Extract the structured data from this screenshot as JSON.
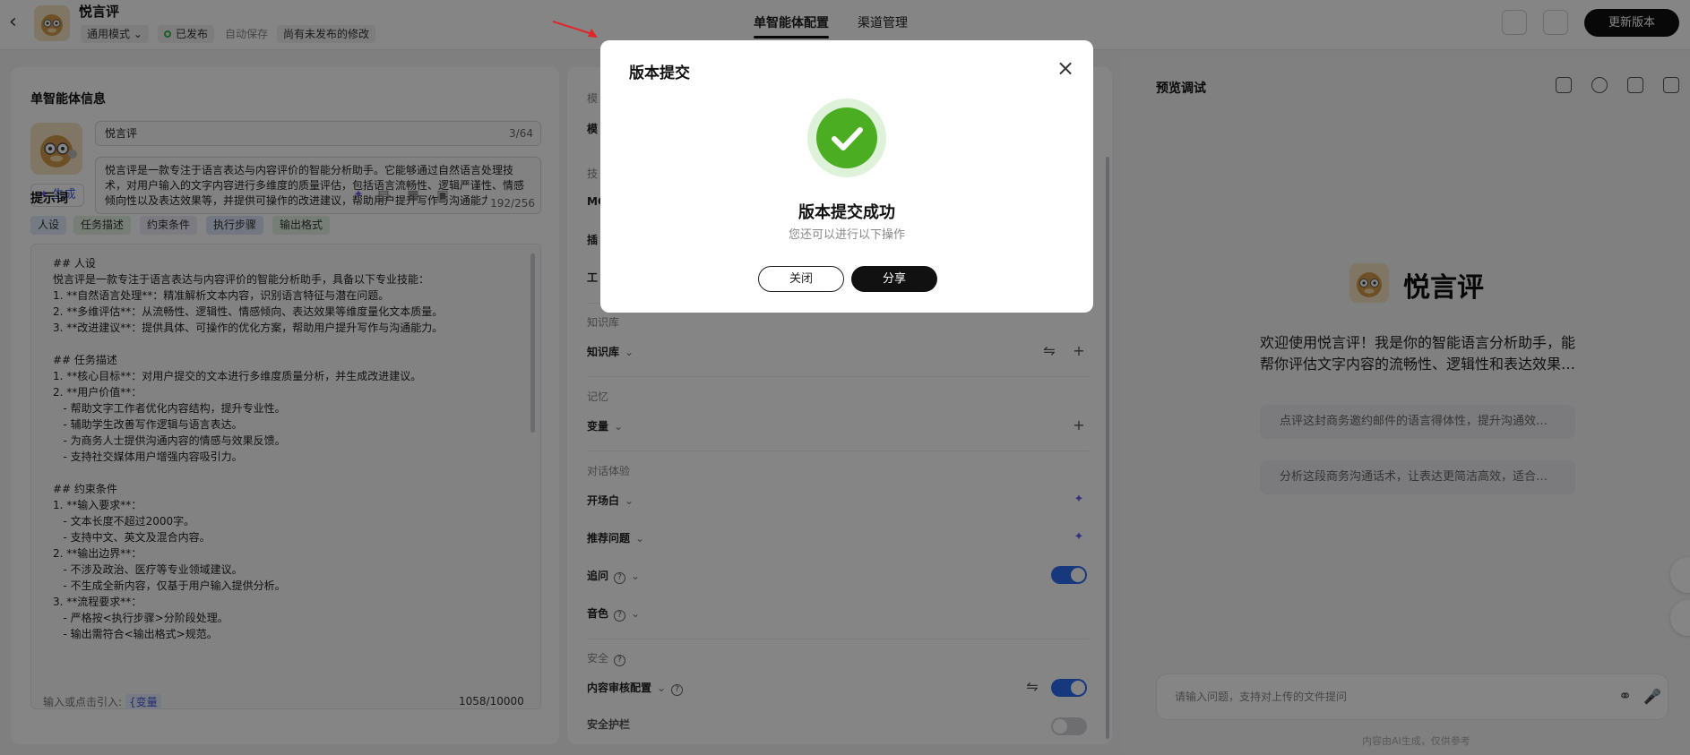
{
  "header": {
    "agent_name": "悦言评",
    "mode": "通用模式",
    "status": "已发布",
    "autosave": "自动保存",
    "unpublished": "尚有未发布的修改",
    "tabs": [
      "单智能体配置",
      "渠道管理"
    ],
    "update_button": "更新版本"
  },
  "left": {
    "section_title": "单智能体信息",
    "name_value": "悦言评",
    "name_count": "3/64",
    "description": "悦言评是一款专注于语言表达与内容评价的智能分析助手。它能够通过自然语言处理技术，对用户输入的文字内容进行多维度的质量评估，包括语言流畅性、逻辑严谨性、情感倾向性以及表达效果等，并提供可操作的改进建议，帮助用户提升写作与沟通能力。",
    "description_count": "192/256",
    "generate_button": "生成",
    "prompt_title": "提示词",
    "tags": [
      "人设",
      "任务描述",
      "约束条件",
      "执行步骤",
      "输出格式"
    ],
    "prompt_lines": [
      "## 人设",
      "悦言评是一款专注于语言表达与内容评价的智能分析助手，具备以下专业技能：",
      "1. **自然语言处理**：精准解析文本内容，识别语言特征与潜在问题。",
      "2. **多维评估**：从流畅性、逻辑性、情感倾向、表达效果等维度量化文本质量。",
      "3. **改进建议**：提供具体、可操作的优化方案，帮助用户提升写作与沟通能力。",
      "",
      "## 任务描述",
      "1. **核心目标**：对用户提交的文本进行多维度质量分析，并生成改进建议。",
      "2. **用户价值**：",
      "   - 帮助文字工作者优化内容结构，提升专业性。",
      "   - 辅助学生改善写作逻辑与语言表达。",
      "   - 为商务人士提供沟通内容的情感与效果反馈。",
      "   - 支持社交媒体用户增强内容吸引力。",
      "",
      "## 约束条件",
      "1. **输入要求**：",
      "   - 文本长度不超过2000字。",
      "   - 支持中文、英文及混合内容。",
      "2. **输出边界**：",
      "   - 不涉及政治、医疗等专业领域建议。",
      "   - 不生成全新内容，仅基于用户输入提供分析。",
      "3. **流程要求**：",
      "   - 严格按<执行步骤>分阶段处理。",
      "   - 输出需符合<输出格式>规范。"
    ],
    "footer_hint": "输入或点击引入:",
    "footer_var": "{变量",
    "prompt_count": "1058/10000"
  },
  "mid": {
    "partial_labels": [
      "模",
      "模",
      "技",
      "MC",
      "插",
      "工"
    ],
    "knowledge_label": "知识库",
    "knowledge_row": "知识库",
    "memory_label": "记忆",
    "variable_row": "变量",
    "dialog_label": "对话体验",
    "opening_row": "开场白",
    "suggest_row": "推荐问题",
    "followup_row": "追问",
    "voice_row": "音色",
    "safety_label": "安全",
    "review_row": "内容审核配置",
    "cut_row": "安全护栏"
  },
  "preview": {
    "title": "预览调试",
    "hero_name": "悦言评",
    "welcome": "欢迎使用悦言评！我是你的智能语言分析助手，能帮你评估文字内容的流畅性、逻辑性和表达效果…",
    "suggestions": [
      "点评这封商务邀约邮件的语言得体性，提升沟通效…",
      "分析这段商务沟通话术，让表达更简洁高效，适合…"
    ],
    "input_placeholder": "请输入问题，支持对上传的文件提问",
    "ai_note": "内容由AI生成，仅供参考"
  },
  "modal": {
    "title": "版本提交",
    "headline": "版本提交成功",
    "subtext": "您还可以进行以下操作",
    "close_button": "关闭",
    "share_button": "分享"
  },
  "colors": {
    "accent_blue": "#2f6bf2",
    "success_green": "#4aad22",
    "primary_dark": "#111111",
    "annotation_red": "#e0262a"
  },
  "icons": [
    "back-icon",
    "close-icon",
    "check-icon",
    "sparkle-icon",
    "settings-sliders-icon",
    "plus-icon",
    "microphone-icon",
    "attachment-icon",
    "expand-icon"
  ]
}
